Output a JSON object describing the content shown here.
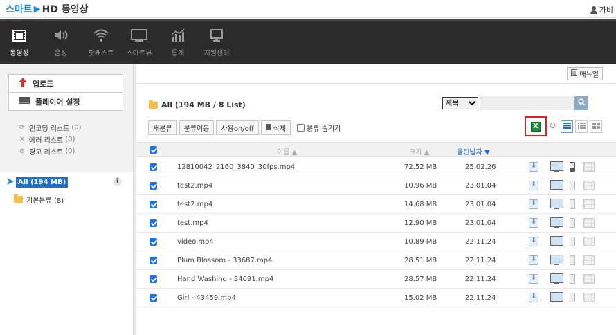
{
  "header": {
    "logo_smart": "스마트",
    "logo_hd": "HD 동영상",
    "user_name": "가비"
  },
  "nav": [
    {
      "label": "동영상",
      "icon": "film-icon",
      "active": true
    },
    {
      "label": "음성",
      "icon": "speaker-icon",
      "active": false
    },
    {
      "label": "팟캐스트",
      "icon": "wifi-icon",
      "active": false
    },
    {
      "label": "스마트뷰",
      "icon": "screen-icon",
      "active": false
    },
    {
      "label": "통계",
      "icon": "chart-icon",
      "active": false
    },
    {
      "label": "지원센터",
      "icon": "monitor-icon",
      "active": false
    }
  ],
  "left": {
    "upload": "업로드",
    "player_settings": "플레이어 설정",
    "stats": [
      {
        "label": "인코딩 리스트",
        "count": "(0)",
        "icon": "encoding-icon"
      },
      {
        "label": "에러 리스트",
        "count": "(0)",
        "icon": "error-icon"
      },
      {
        "label": "경고 리스트",
        "count": "(0)",
        "icon": "warning-icon"
      }
    ],
    "tree_root": "All (194 MB)",
    "tree_child": "기본분류 (8)",
    "info": "i"
  },
  "main": {
    "manual": "매뉴얼",
    "title": "All (194 MB / 8 List)",
    "search_option": "제목",
    "toolbar": [
      "새분류",
      "분류이동",
      "사용on/off",
      "삭제"
    ],
    "hide_category": "분류 숨기기",
    "columns": {
      "name": "이름 ▲",
      "size": "크기 ▲",
      "date": "올린날자 ▼"
    },
    "rows": [
      {
        "name": "12810042_2160_3840_30fps.mp4",
        "size": "72.52 MB",
        "date": "25.02.26",
        "mobile": true
      },
      {
        "name": "test2.mp4",
        "size": "10.96 MB",
        "date": "23.01.04",
        "mobile": false
      },
      {
        "name": "test2.mp4",
        "size": "14.68 MB",
        "date": "23.01.04",
        "mobile": false
      },
      {
        "name": "test.mp4",
        "size": "12.90 MB",
        "date": "23.01.04",
        "mobile": false
      },
      {
        "name": "video.mp4",
        "size": "10.89 MB",
        "date": "22.11.24",
        "mobile": false
      },
      {
        "name": "Plum Blossom - 33687.mp4",
        "size": "28.51 MB",
        "date": "22.11.24",
        "mobile": false
      },
      {
        "name": "Hand Washing - 34091.mp4",
        "size": "28.57 MB",
        "date": "22.11.24",
        "mobile": false
      },
      {
        "name": "Girl - 43459.mp4",
        "size": "15.02 MB",
        "date": "22.11.24",
        "mobile": false
      }
    ]
  },
  "colors": {
    "accent": "#1e6fd0",
    "nav_bg": "#2b2b2b",
    "excel_highlight": "#e02020",
    "checkbox": "#1a73e8"
  }
}
